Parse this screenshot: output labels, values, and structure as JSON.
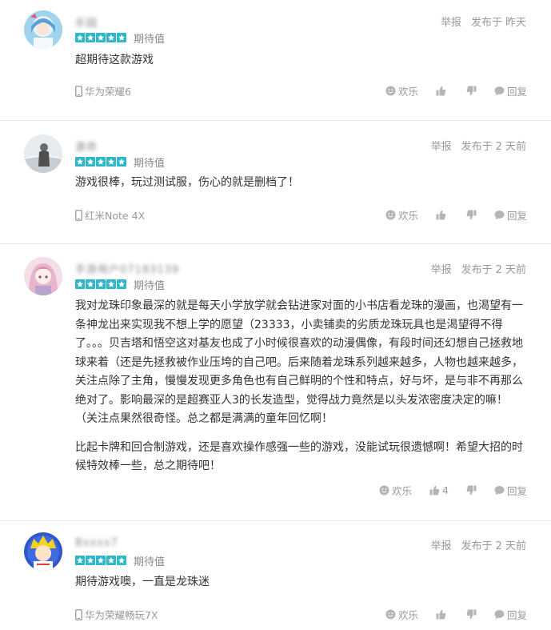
{
  "colors": {
    "star": "#2eb7c8",
    "muted": "#999999"
  },
  "labels": {
    "report": "举报",
    "posted_prefix": "发布于",
    "fun": "欢乐",
    "reply": "回复"
  },
  "reviews": [
    {
      "username": "乐园",
      "stars": 5,
      "rating_label": "期待值",
      "posted": "昨天",
      "content": [
        "超期待这款游戏"
      ],
      "device": "华为荣耀6",
      "likes": ""
    },
    {
      "username": "源奇",
      "stars": 5,
      "rating_label": "期待值",
      "posted": "2 天前",
      "content": [
        "游戏很棒，玩过测试服，伤心的就是删档了！"
      ],
      "device": "红米Note 4X",
      "likes": ""
    },
    {
      "username": "手游用户07183139",
      "stars": 5,
      "rating_label": "期待值",
      "posted": "2 天前",
      "content": [
        "我对龙珠印象最深的就是每天小学放学就会钻进家对面的小书店看龙珠的漫画，也渴望有一条神龙出来实现我不想上学的愿望（23333，小卖铺卖的劣质龙珠玩具也是渴望得不得了。。。贝吉塔和悟空这对基友也成了小时候很喜欢的动漫偶像，有段时间还幻想自己拯救地球来着（还是先拯救被作业压垮的自己吧。后来随着龙珠系列越来越多，人物也越来越多，关注点除了主角，慢慢发现更多角色也有自己鲜明的个性和特点，好与坏，是与非不再那么绝对了。影响最深的是超赛亚人3的长发造型，觉得战力竟然是以头发浓密度决定的嘛！（关注点果然很奇怪。总之都是满满的童年回忆啊！",
        "比起卡牌和回合制游戏，还是喜欢操作感强一些的游戏，没能试玩很遗憾啊！希望大招的时候特效棒一些，总之期待吧！"
      ],
      "device": "",
      "likes": "4"
    },
    {
      "username": "Bxxxx7",
      "stars": 5,
      "rating_label": "期待值",
      "posted": "2 天前",
      "content": [
        "期待游戏噢，一直是龙珠迷"
      ],
      "device": "华为荣耀畅玩7X",
      "likes": ""
    }
  ]
}
